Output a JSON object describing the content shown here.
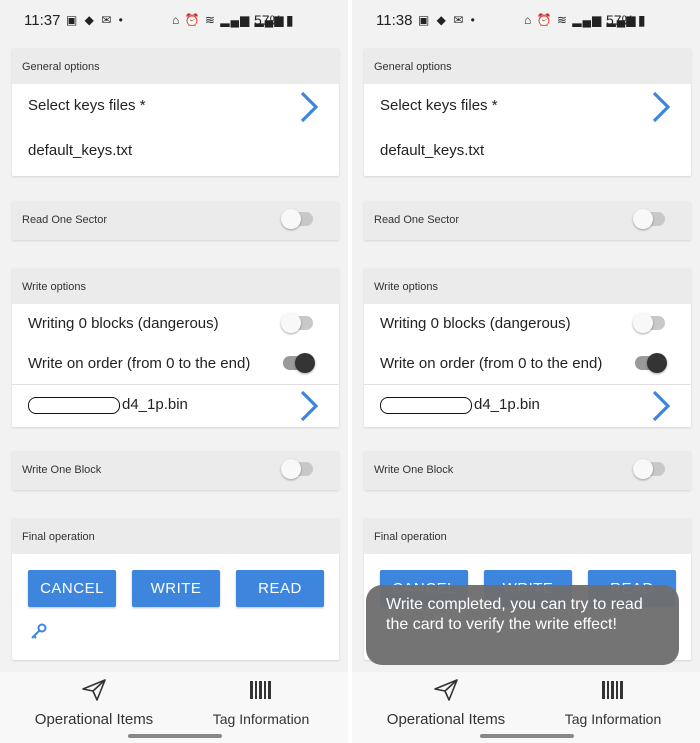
{
  "status_left": {
    "time": "11:37",
    "battery": "57%"
  },
  "status_right": {
    "time": "11:38",
    "battery": "57%"
  },
  "general": {
    "header": "General options",
    "select_keys_label": "Select keys files *",
    "keys_file": "default_keys.txt"
  },
  "read_one": {
    "header": "Read One Sector"
  },
  "write_options": {
    "header": "Write options",
    "writing_zero_label": "Writing 0 blocks (dangerous)",
    "write_order_label": "Write on order (from 0 to the end)",
    "file_suffix": "d4_1p.bin"
  },
  "write_one": {
    "header": "Write One Block"
  },
  "final": {
    "header": "Final operation",
    "cancel_label": "CANCEL",
    "write_label": "WRITE",
    "read_label": "READ"
  },
  "nav": {
    "operational_label": "Operational Items",
    "tag_label": "Tag Information"
  },
  "toast": {
    "message": "Write completed, you can try to read the card to verify the write effect!"
  },
  "colors": {
    "accent": "#3d85dd",
    "background": "#f2f2f2",
    "header": "#ebebeb"
  },
  "toggles": {
    "read_one_sector": false,
    "writing_zero_blocks": false,
    "write_on_order": true,
    "write_one_block": false
  }
}
